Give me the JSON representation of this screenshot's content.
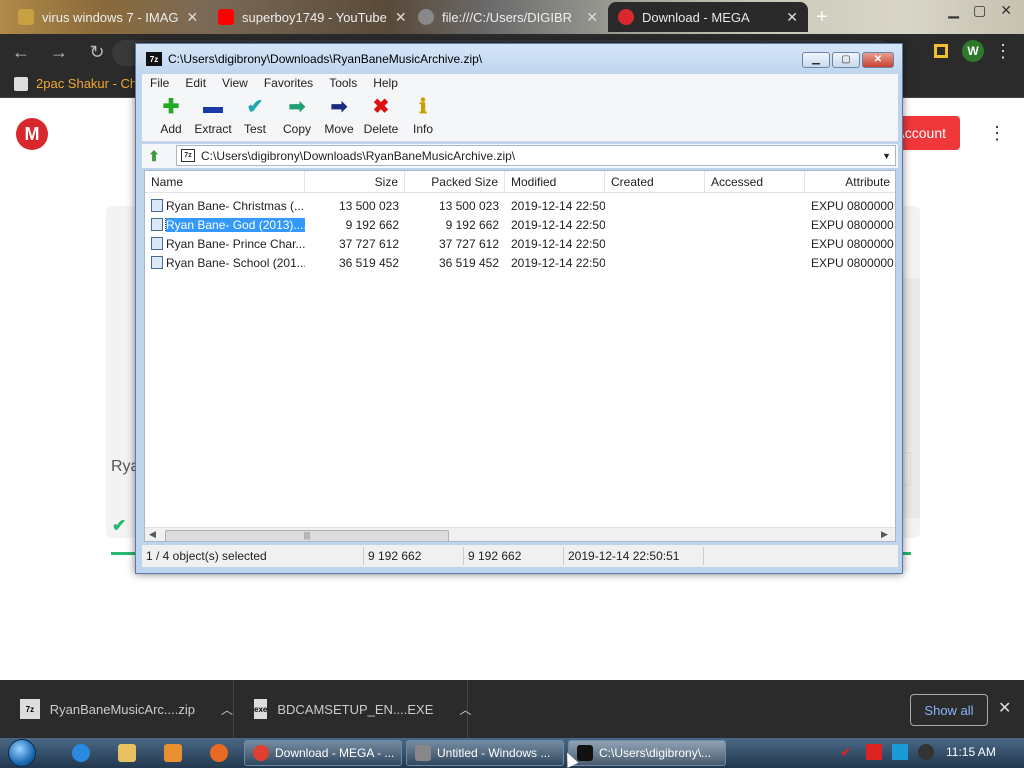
{
  "browser": {
    "tabs": [
      {
        "title": "virus windows 7 - IMAG",
        "favicon_color": "#c8a040"
      },
      {
        "title": "superboy1749 - YouTube",
        "favicon_color": "#ff0000"
      },
      {
        "title": "file:///C:/Users/DIGIBR",
        "favicon_color": "#888888"
      },
      {
        "title": "Download - MEGA",
        "favicon_color": "#d9272e"
      }
    ],
    "new_tab_label": "+",
    "tab_close": "✕",
    "profile_initial": "W",
    "bookmark_label": "2pac Shakur - Chro"
  },
  "mega": {
    "logo": "M",
    "account_button": "Account",
    "file_label": "Rya",
    "brand_color": "#d9272e",
    "progress_color": "#2bb673"
  },
  "sevenzip": {
    "title": "C:\\Users\\digibrony\\Downloads\\RyanBaneMusicArchive.zip\\",
    "app_icon": "7z",
    "menu": [
      "File",
      "Edit",
      "View",
      "Favorites",
      "Tools",
      "Help"
    ],
    "toolbar": [
      {
        "label": "Add",
        "icon": "plus-icon",
        "color": "#22aa22",
        "glyph": "✚"
      },
      {
        "label": "Extract",
        "icon": "minus-icon",
        "color": "#1a3aa8",
        "glyph": "▬"
      },
      {
        "label": "Test",
        "icon": "check-icon",
        "color": "#20a8b0",
        "glyph": "✔"
      },
      {
        "label": "Copy",
        "icon": "copy-arrow-icon",
        "color": "#20a070",
        "glyph": "➡"
      },
      {
        "label": "Move",
        "icon": "move-arrow-icon",
        "color": "#1a2a80",
        "glyph": "➡"
      },
      {
        "label": "Delete",
        "icon": "delete-x-icon",
        "color": "#dd1111",
        "glyph": "✖"
      },
      {
        "label": "Info",
        "icon": "info-icon",
        "color": "#c8a000",
        "glyph": "ℹ"
      }
    ],
    "address": "C:\\Users\\digibrony\\Downloads\\RyanBaneMusicArchive.zip\\",
    "columns": [
      "Name",
      "Size",
      "Packed Size",
      "Modified",
      "Created",
      "Accessed",
      "Attribute"
    ],
    "files": [
      {
        "name": "Ryan Bane- Christmas (...",
        "size": "13 500 023",
        "packed": "13 500 023",
        "modified": "2019-12-14 22:50",
        "created": "",
        "accessed": "",
        "attr": "EXPU 0800000"
      },
      {
        "name": "Ryan Bane- God (2013)....",
        "size": "9 192 662",
        "packed": "9 192 662",
        "modified": "2019-12-14 22:50",
        "created": "",
        "accessed": "",
        "attr": "EXPU 0800000"
      },
      {
        "name": "Ryan Bane- Prince Char...",
        "size": "37 727 612",
        "packed": "37 727 612",
        "modified": "2019-12-14 22:50",
        "created": "",
        "accessed": "",
        "attr": "EXPU 0800000"
      },
      {
        "name": "Ryan Bane- School (201...",
        "size": "36 519 452",
        "packed": "36 519 452",
        "modified": "2019-12-14 22:50",
        "created": "",
        "accessed": "",
        "attr": "EXPU 0800000"
      }
    ],
    "selected_index": 1,
    "status": {
      "selection": "1 / 4 object(s) selected",
      "size": "9 192 662",
      "packed": "9 192 662",
      "modified": "2019-12-14 22:50:51"
    }
  },
  "downloads": {
    "items": [
      {
        "name": "RyanBaneMusicArc....zip",
        "icon": "7z"
      },
      {
        "name": "BDCAMSETUP_EN....EXE",
        "icon": "exe"
      }
    ],
    "show_all": "Show all",
    "close": "✕"
  },
  "taskbar": {
    "buttons": [
      {
        "label": "Download - MEGA - ...",
        "icon_color": "#e04030"
      },
      {
        "label": "Untitled - Windows ...",
        "icon_color": "#888888"
      },
      {
        "label": "C:\\Users\\digibrony\\...",
        "icon_color": "#111111"
      }
    ],
    "time": "11:15 AM"
  }
}
